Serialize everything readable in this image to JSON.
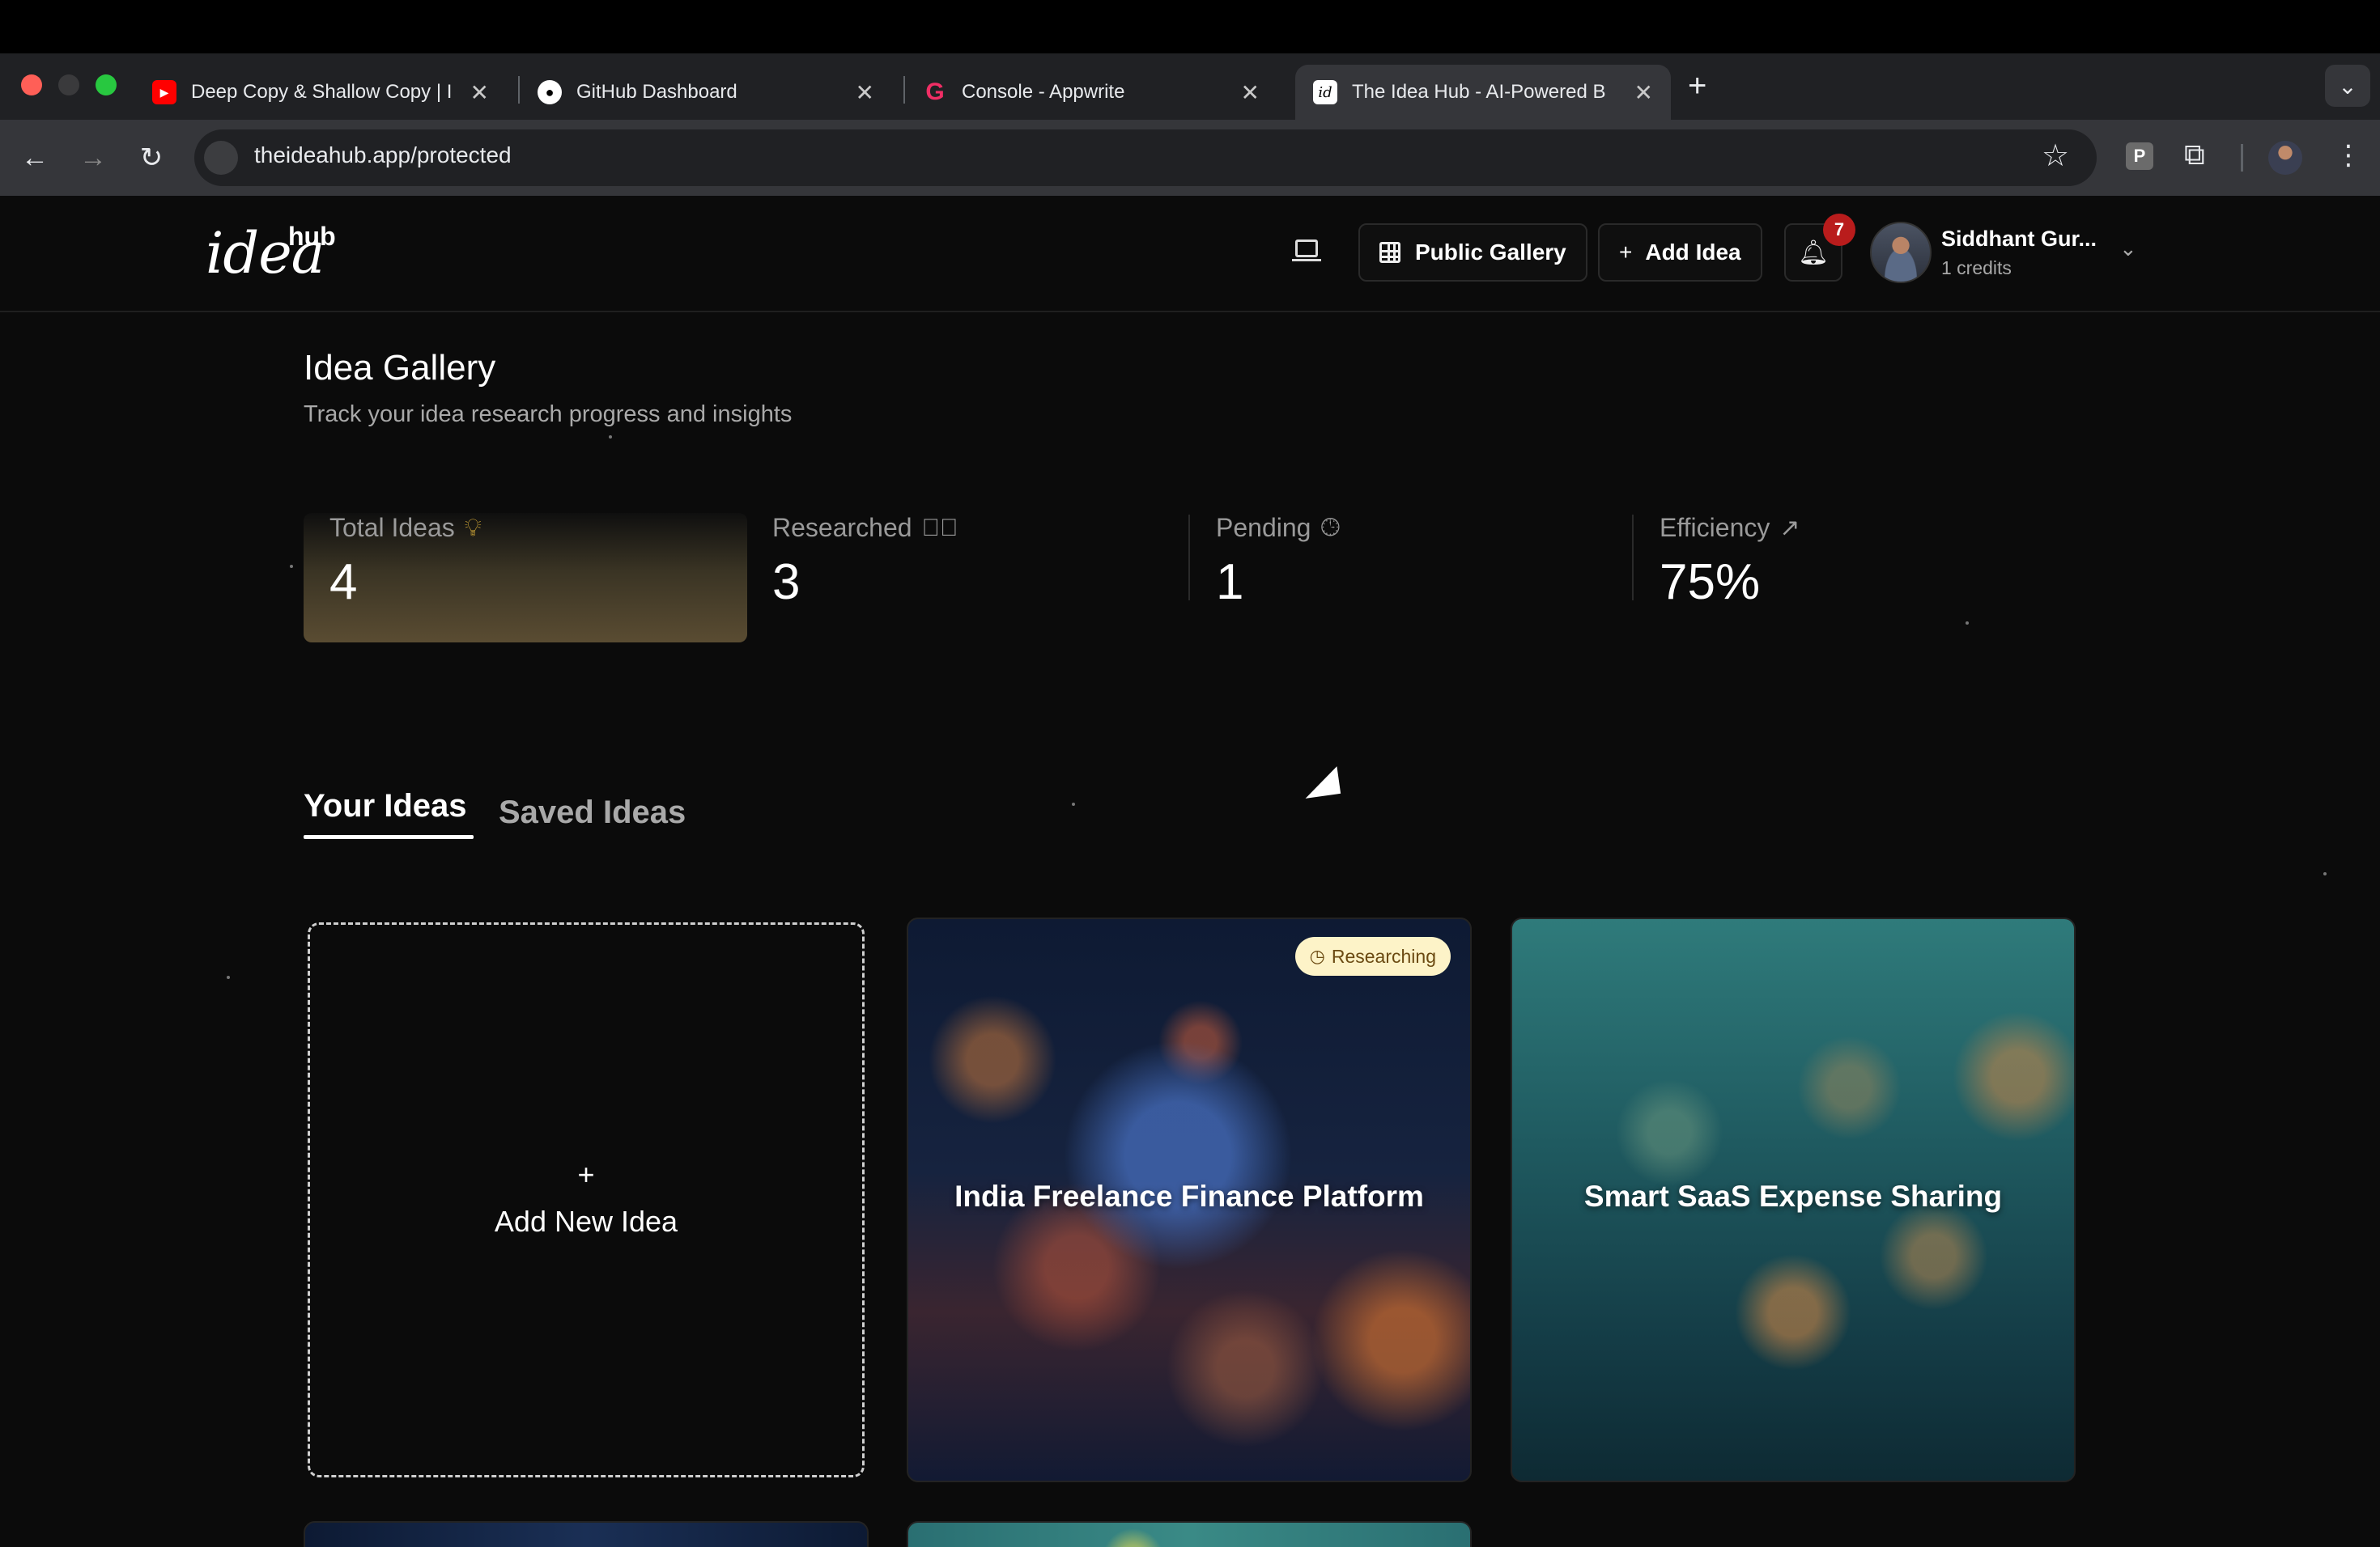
{
  "browser": {
    "tabs": [
      {
        "title": "Deep Copy & Shallow Copy | I",
        "favicon": "youtube-icon"
      },
      {
        "title": "GitHub Dashboard",
        "favicon": "github-icon"
      },
      {
        "title": "Console - Appwrite",
        "favicon": "appwrite-icon"
      },
      {
        "title": "The Idea Hub - AI-Powered B",
        "favicon": "ideahub-icon",
        "active": true
      }
    ],
    "url": "theideahub.app/protected",
    "profile_ext_letter": "P"
  },
  "header": {
    "logo_main": "idea",
    "logo_sup": "hub",
    "public_gallery": "Public Gallery",
    "add_idea": "Add Idea",
    "notification_count": "7",
    "user_name": "Siddhant Gur...",
    "user_credits": "1 credits"
  },
  "page": {
    "title": "Idea Gallery",
    "subtitle": "Track your idea research progress and insights"
  },
  "stats": [
    {
      "label": "Total Ideas",
      "value": "4",
      "icon": "lightbulb-icon"
    },
    {
      "label": "Researched",
      "value": "3",
      "icon": "check-circle-icon"
    },
    {
      "label": "Pending",
      "value": "1",
      "icon": "clock-icon"
    },
    {
      "label": "Efficiency",
      "value": "75%",
      "icon": "trending-up-icon"
    }
  ],
  "tabs": {
    "your_ideas": "Your Ideas",
    "saved_ideas": "Saved Ideas"
  },
  "add_card": {
    "plus": "+",
    "label": "Add New Idea"
  },
  "ideas": [
    {
      "title": "India Freelance Finance Platform",
      "status": "Researching"
    },
    {
      "title": "Smart SaaS Expense Sharing",
      "status": ""
    }
  ],
  "colors": {
    "accent_badge": "#fdf3c8",
    "notification": "#b91c1c",
    "highlight": "#5a4c32"
  }
}
